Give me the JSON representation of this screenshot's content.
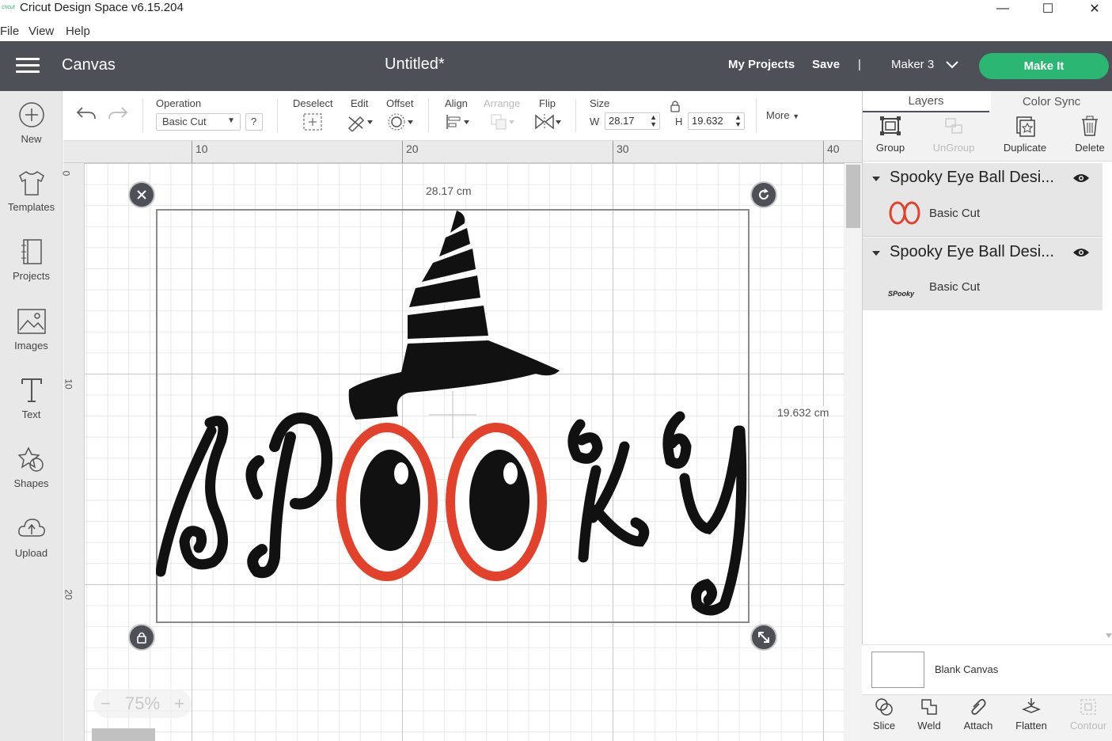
{
  "window": {
    "logo_text": "cricut",
    "title": "Cricut Design Space  v6.15.204",
    "minimize": "—",
    "maximize": "☐",
    "close": "✕"
  },
  "menu": {
    "items": [
      "File",
      "View",
      "Help"
    ]
  },
  "header": {
    "title": "Canvas",
    "document_title": "Untitled*",
    "my_projects": "My Projects",
    "save": "Save",
    "divider": "|",
    "machine": "Maker 3",
    "make_it": "Make It",
    "accent_color": "#2bb673",
    "bar_color": "#4d5057"
  },
  "sidebar": {
    "items": [
      {
        "label": "New",
        "icon": "plus-circle-icon"
      },
      {
        "label": "Templates",
        "icon": "tshirt-icon"
      },
      {
        "label": "Projects",
        "icon": "projects-icon"
      },
      {
        "label": "Images",
        "icon": "image-icon"
      },
      {
        "label": "Text",
        "icon": "text-icon"
      },
      {
        "label": "Shapes",
        "icon": "shapes-icon"
      },
      {
        "label": "Upload",
        "icon": "upload-cloud-icon"
      }
    ]
  },
  "toolbar": {
    "operation_label": "Operation",
    "operation_value": "Basic Cut",
    "help": "?",
    "deselect": "Deselect",
    "edit": "Edit",
    "offset": "Offset",
    "align": "Align",
    "arrange": "Arrange",
    "flip": "Flip",
    "size": "Size",
    "w_label": "W",
    "w_value": "28.17",
    "h_label": "H",
    "h_value": "19.632",
    "more": "More"
  },
  "rulers": {
    "top": [
      "10",
      "20",
      "30",
      "40"
    ],
    "left": [
      "0",
      "10",
      "20"
    ]
  },
  "canvas": {
    "width_label": "28.17 cm",
    "height_label": "19.632 cm",
    "zoom": "75%",
    "zoom_minus": "−",
    "zoom_plus": "+",
    "design_colors": {
      "ink": "#111111",
      "eye_rim": "#e2412b"
    }
  },
  "panel": {
    "tabs": [
      "Layers",
      "Color Sync"
    ],
    "tools": [
      {
        "label": "Group",
        "enabled": true
      },
      {
        "label": "UnGroup",
        "enabled": false
      },
      {
        "label": "Duplicate",
        "enabled": true
      },
      {
        "label": "Delete",
        "enabled": true
      }
    ],
    "layers": [
      {
        "name": "Spooky Eye Ball Desi...",
        "operation": "Basic Cut"
      },
      {
        "name": "Spooky Eye Ball Desi...",
        "operation": "Basic Cut"
      }
    ],
    "thumbnail_text": "SPooky",
    "blank_canvas": "Blank Canvas",
    "bottom_tools": [
      {
        "label": "Slice",
        "enabled": true
      },
      {
        "label": "Weld",
        "enabled": true
      },
      {
        "label": "Attach",
        "enabled": true
      },
      {
        "label": "Flatten",
        "enabled": true
      },
      {
        "label": "Contour",
        "enabled": false
      }
    ]
  }
}
